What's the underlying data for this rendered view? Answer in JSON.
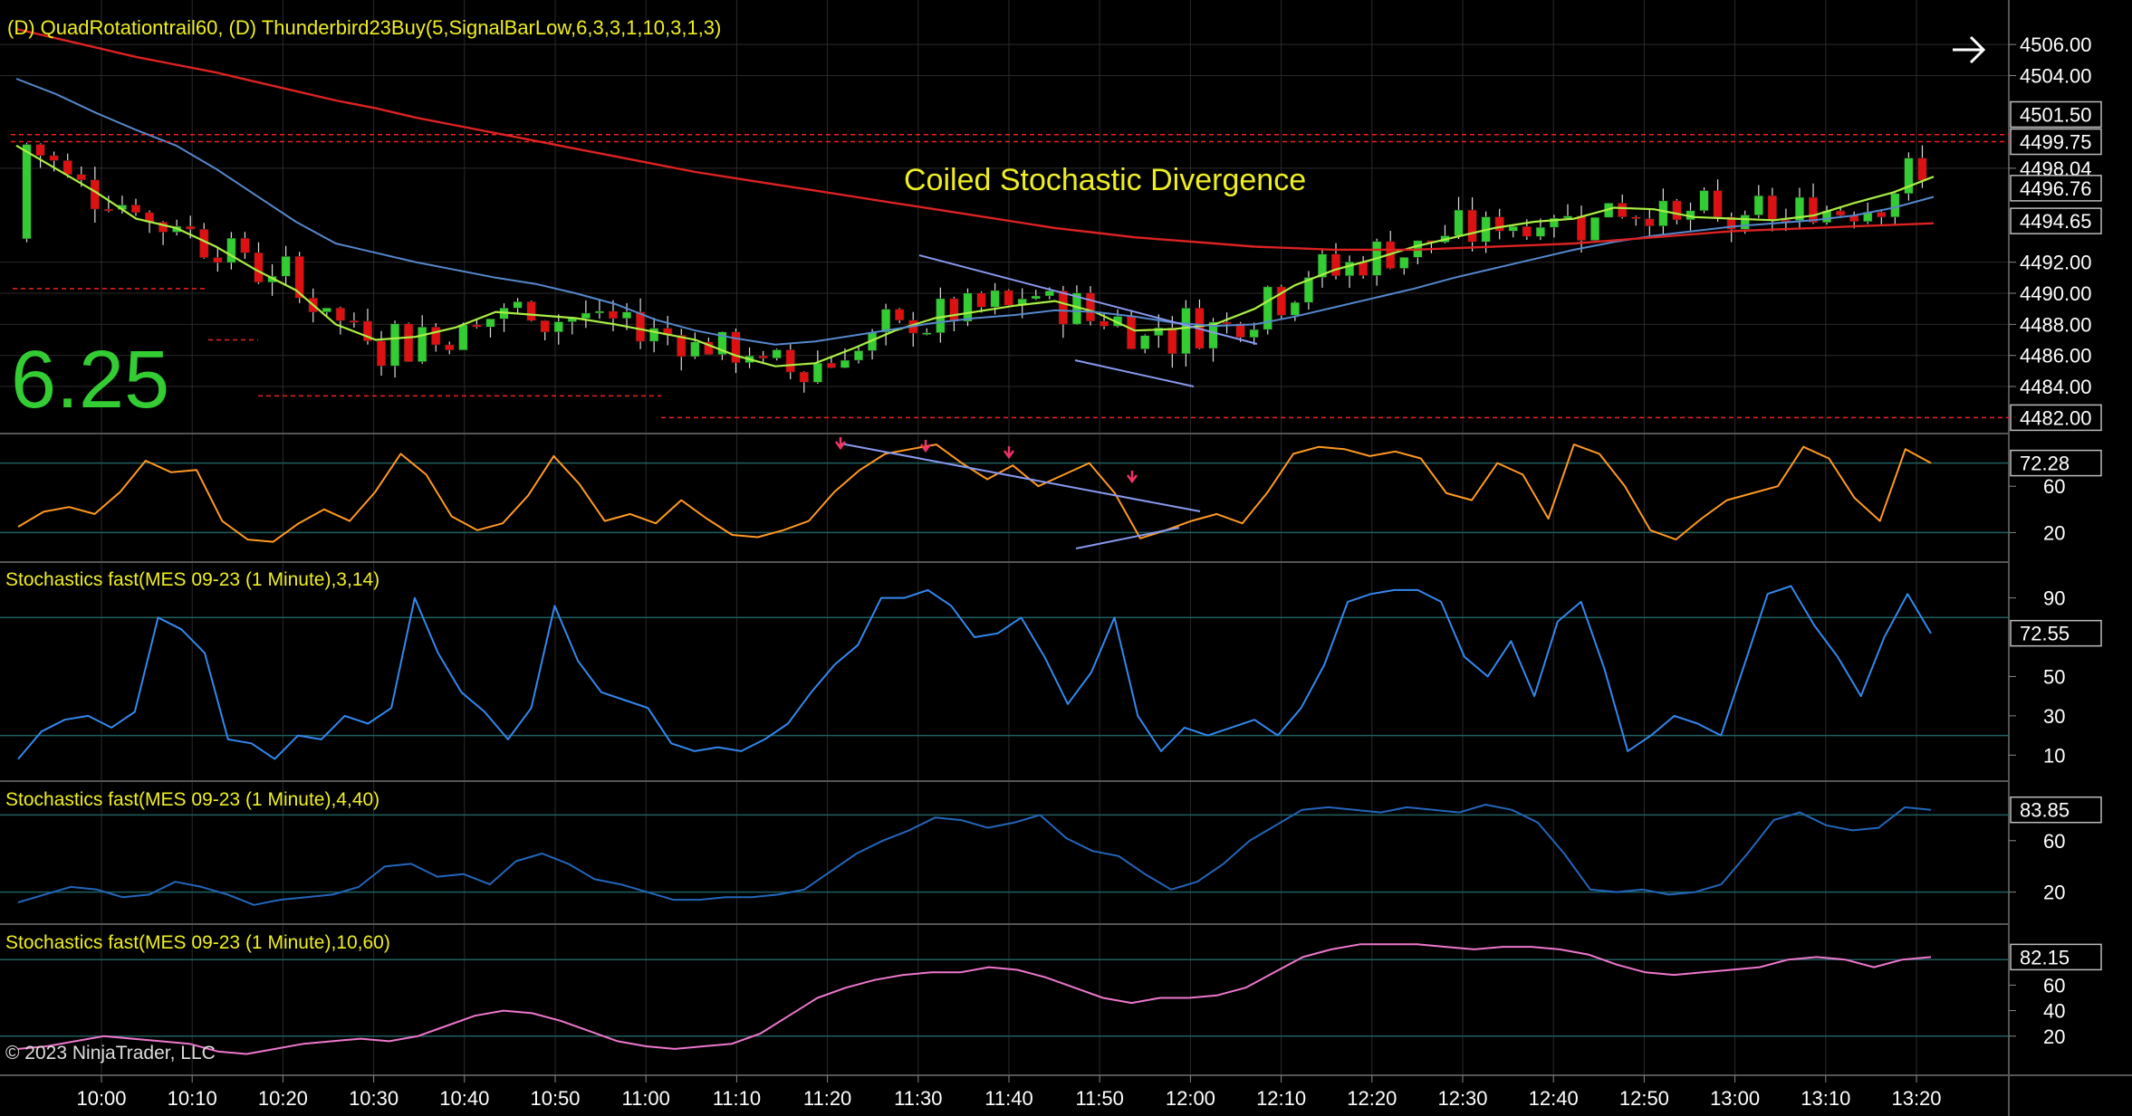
{
  "header": {
    "indicators_label": "(D) QuadRotationtrail60, (D) Thunderbird23Buy(5,SignalBarLow,6,3,3,1,10,3,1,3)",
    "annotation": "Coiled Stochastic Divergence",
    "big_number": "6.25",
    "copyright": "© 2023 NinjaTrader, LLC"
  },
  "colors": {
    "background": "#000000",
    "grid": "#2a2a2a",
    "up_candle": "#33cc33",
    "down_candle": "#dd1111",
    "ema_fast": "#aaee44",
    "ema_slow": "#5588cc",
    "sma_long": "#dd2222",
    "stoch_orange": "#ff9922",
    "stoch_blue1": "#3388ee",
    "stoch_blue2": "#2266bb",
    "stoch_pink": "#ee77cc",
    "trendline": "#8899ee",
    "annotation_text": "#eeee22",
    "big_number": "#33cc33",
    "level_line": "#1f5f5f"
  },
  "chart_data": [
    {
      "type": "candlestick",
      "panel": "price",
      "y_ticks": [
        "4506.00",
        "4504.00",
        "4501.50",
        "4499.75",
        "4498.04",
        "4496.76",
        "4494.65",
        "4492.00",
        "4490.00",
        "4488.00",
        "4486.00",
        "4484.00",
        "4482.00"
      ],
      "price_labels": [
        "4501.50",
        "4499.75",
        "4496.76",
        "4494.65",
        "4482.00"
      ],
      "ylim": [
        4481.5,
        4507
      ],
      "x_ticks": [
        "10:00",
        "10:10",
        "10:20",
        "10:30",
        "10:40",
        "10:50",
        "11:00",
        "11:10",
        "11:20",
        "11:30",
        "11:40",
        "11:50",
        "12:00",
        "12:10",
        "12:20",
        "12:30",
        "12:40",
        "12:50",
        "13:00",
        "13:10",
        "13:20"
      ],
      "series": [
        {
          "name": "EMA fast",
          "values": [
            4499.5,
            4498.0,
            4496.5,
            4494.8,
            4494.2,
            4493.0,
            4491.5,
            4490.2,
            4488.0,
            4487.0,
            4487.2,
            4487.8,
            4488.8,
            4488.6,
            4488.4,
            4488.0,
            4487.5,
            4487.0,
            4486.0,
            4485.3,
            4485.5,
            4486.5,
            4487.6,
            4488.4,
            4488.8,
            4489.2,
            4489.5,
            4488.8,
            4487.6,
            4487.7,
            4488.0,
            4489.0,
            4490.5,
            4491.5,
            4492.2,
            4493.0,
            4493.6,
            4494.2,
            4494.6,
            4494.8,
            4495.5,
            4495.4,
            4494.9,
            4494.8,
            4494.7,
            4495.0,
            4495.8,
            4496.5,
            4497.5
          ]
        },
        {
          "name": "EMA slow",
          "values": [
            4503.8,
            4502.8,
            4501.6,
            4500.5,
            4499.5,
            4498.0,
            4496.3,
            4494.6,
            4493.2,
            4492.6,
            4492.0,
            4491.5,
            4491.0,
            4490.6,
            4490.0,
            4489.3,
            4488.3,
            4487.6,
            4487.1,
            4486.7,
            4486.9,
            4487.3,
            4487.7,
            4488.1,
            4488.4,
            4488.6,
            4488.9,
            4488.8,
            4488.5,
            4488.1,
            4487.9,
            4488.0,
            4488.5,
            4489.1,
            4489.7,
            4490.3,
            4491.0,
            4491.6,
            4492.2,
            4492.8,
            4493.3,
            4493.7,
            4494.0,
            4494.3,
            4494.5,
            4494.7,
            4495.0,
            4495.5,
            4496.2
          ]
        },
        {
          "name": "SMA long",
          "values": [
            4507.0,
            4506.4,
            4505.8,
            4505.2,
            4504.7,
            4504.2,
            4503.6,
            4503.0,
            4502.4,
            4501.9,
            4501.3,
            4500.8,
            4500.3,
            4499.8,
            4499.3,
            4498.8,
            4498.3,
            4497.8,
            4497.4,
            4497.0,
            4496.6,
            4496.2,
            4495.8,
            4495.4,
            4495.0,
            4494.6,
            4494.2,
            4493.9,
            4493.6,
            4493.4,
            4493.2,
            4493.0,
            4492.9,
            4492.8,
            4492.8,
            4492.8,
            4492.9,
            4493.0,
            4493.1,
            4493.2,
            4493.4,
            4493.6,
            4493.8,
            4494.0,
            4494.1,
            4494.2,
            4494.3,
            4494.4,
            4494.5
          ]
        }
      ]
    },
    {
      "type": "line",
      "panel": "stoch_1",
      "name": "",
      "y_ticks": [
        "60",
        "20"
      ],
      "levels": [
        80,
        20
      ],
      "last_value_label": "72.28",
      "ylim": [
        0,
        100
      ],
      "values": [
        25,
        38,
        42,
        36,
        55,
        82,
        72,
        74,
        30,
        14,
        12,
        28,
        40,
        30,
        55,
        88,
        70,
        34,
        22,
        28,
        52,
        86,
        62,
        30,
        36,
        28,
        48,
        32,
        18,
        16,
        22,
        30,
        55,
        74,
        88,
        92,
        96,
        80,
        66,
        78,
        60,
        70,
        80,
        54,
        15,
        22,
        30,
        36,
        28,
        55,
        88,
        94,
        92,
        86,
        90,
        84,
        54,
        48,
        80,
        70,
        32,
        96,
        88,
        60,
        22,
        14,
        32,
        48,
        54,
        60,
        94,
        84,
        50,
        30,
        92,
        80
      ]
    },
    {
      "type": "line",
      "panel": "stoch_2",
      "name": "Stochastics fast(MES 09-23 (1 Minute),3,14)",
      "y_ticks": [
        "90",
        "50",
        "30",
        "10"
      ],
      "levels": [
        80,
        20
      ],
      "last_value_label": "72.55",
      "ylim": [
        0,
        105
      ],
      "values": [
        8,
        22,
        28,
        30,
        24,
        32,
        80,
        74,
        62,
        18,
        16,
        8,
        20,
        18,
        30,
        26,
        34,
        90,
        62,
        42,
        32,
        18,
        34,
        86,
        58,
        42,
        38,
        34,
        16,
        12,
        14,
        12,
        18,
        26,
        42,
        56,
        66,
        90,
        90,
        94,
        86,
        70,
        72,
        80,
        60,
        36,
        52,
        80,
        30,
        12,
        24,
        20,
        24,
        28,
        20,
        34,
        56,
        88,
        92,
        94,
        94,
        88,
        60,
        50,
        68,
        40,
        78,
        88,
        54,
        12,
        20,
        30,
        26,
        20,
        56,
        92,
        96,
        76,
        60,
        40,
        70,
        92,
        72
      ]
    },
    {
      "type": "line",
      "panel": "stoch_3",
      "name": "Stochastics fast(MES 09-23 (1 Minute),4,40)",
      "y_ticks": [
        "60",
        "20"
      ],
      "levels": [
        80,
        20
      ],
      "last_value_label": "83.85",
      "ylim": [
        0,
        100
      ],
      "values": [
        12,
        18,
        24,
        22,
        16,
        18,
        28,
        24,
        18,
        10,
        14,
        16,
        18,
        24,
        40,
        42,
        32,
        34,
        26,
        44,
        50,
        42,
        30,
        26,
        20,
        14,
        14,
        16,
        16,
        18,
        22,
        36,
        50,
        60,
        68,
        78,
        76,
        70,
        74,
        80,
        62,
        52,
        48,
        34,
        22,
        28,
        42,
        60,
        72,
        84,
        86,
        84,
        82,
        86,
        84,
        82,
        88,
        84,
        74,
        50,
        22,
        20,
        22,
        18,
        20,
        26,
        50,
        76,
        82,
        72,
        68,
        70,
        86,
        84
      ]
    },
    {
      "type": "line",
      "panel": "stoch_4",
      "name": "Stochastics fast(MES 09-23 (1 Minute),10,60)",
      "y_ticks": [
        "60",
        "40",
        "20"
      ],
      "levels": [
        80,
        20
      ],
      "last_value_label": "82.15",
      "ylim": [
        -5,
        100
      ],
      "values": [
        10,
        12,
        16,
        20,
        18,
        16,
        14,
        8,
        6,
        10,
        14,
        16,
        18,
        16,
        20,
        28,
        36,
        40,
        38,
        32,
        24,
        16,
        12,
        10,
        12,
        14,
        22,
        36,
        50,
        58,
        64,
        68,
        70,
        70,
        74,
        72,
        66,
        58,
        50,
        46,
        50,
        50,
        52,
        58,
        70,
        82,
        88,
        92,
        92,
        92,
        90,
        88,
        90,
        90,
        88,
        84,
        76,
        70,
        68,
        70,
        72,
        74,
        80,
        82,
        80,
        74,
        80,
        82
      ]
    }
  ]
}
